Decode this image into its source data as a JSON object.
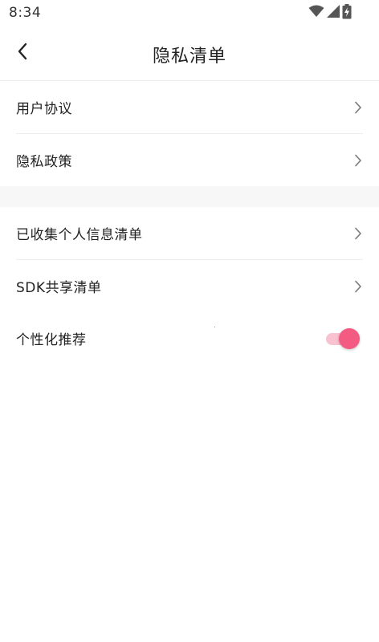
{
  "status_bar": {
    "time": "8:34",
    "icons": [
      "wifi-icon",
      "cellular-signal-icon",
      "battery-charging-icon"
    ]
  },
  "header": {
    "back_icon": "chevron-left-icon",
    "title": "隐私清单"
  },
  "groups": [
    {
      "items": [
        {
          "label": "用户协议",
          "trailing": "chevron-right-icon"
        },
        {
          "label": "隐私政策",
          "trailing": "chevron-right-icon"
        }
      ]
    },
    {
      "items": [
        {
          "label": "已收集个人信息清单",
          "trailing": "chevron-right-icon"
        },
        {
          "label": "SDK共享清单",
          "trailing": "chevron-right-icon"
        },
        {
          "label": "个性化推荐",
          "trailing": "toggle",
          "toggle_on": true
        }
      ]
    }
  ],
  "colors": {
    "accent": "#f45b82",
    "accent_track": "#f9c2d0",
    "section_gap": "#f7f7f7",
    "divider": "#ececec",
    "chevron": "#777777"
  }
}
